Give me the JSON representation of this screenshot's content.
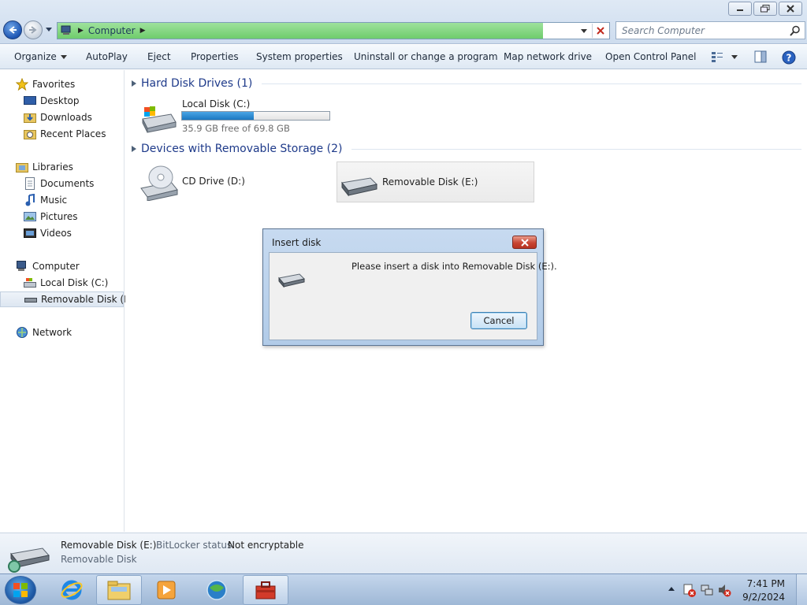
{
  "window": {
    "address_crumb": "Computer",
    "address_load_percent": 88,
    "search_placeholder": "Search Computer"
  },
  "toolbar": {
    "organize": "Organize",
    "autoplay": "AutoPlay",
    "eject": "Eject",
    "properties": "Properties",
    "system_properties": "System properties",
    "uninstall": "Uninstall or change a program",
    "map_network": "Map network drive",
    "control_panel": "Open Control Panel"
  },
  "nav": {
    "favorites": "Favorites",
    "desktop": "Desktop",
    "downloads": "Downloads",
    "recent": "Recent Places",
    "libraries": "Libraries",
    "documents": "Documents",
    "music": "Music",
    "pictures": "Pictures",
    "videos": "Videos",
    "computer": "Computer",
    "local_disk": "Local Disk (C:)",
    "removable": "Removable Disk (E:)",
    "network": "Network"
  },
  "content": {
    "hard_disk_header": "Hard Disk Drives (1)",
    "local_disk": {
      "name": "Local Disk (C:)",
      "free_text": "35.9 GB free of 69.8 GB",
      "used_fraction": 0.486
    },
    "removable_header": "Devices with Removable Storage (2)",
    "cd_drive": "CD Drive (D:)",
    "removable_disk": "Removable Disk (E:)"
  },
  "dialog": {
    "title": "Insert disk",
    "message": "Please insert a disk into Removable Disk (E:).",
    "cancel": "Cancel"
  },
  "details": {
    "name": "Removable Disk (E:)",
    "bitlocker_label": "BitLocker status:",
    "bitlocker_value": "Not encryptable",
    "type": "Removable Disk"
  },
  "taskbar": {
    "time": "7:41 PM",
    "date": "9/2/2024"
  },
  "colors": {
    "accent_blue": "#1e3a8a",
    "capacity_fill": "#1c78c0",
    "close_red": "#c84634"
  }
}
